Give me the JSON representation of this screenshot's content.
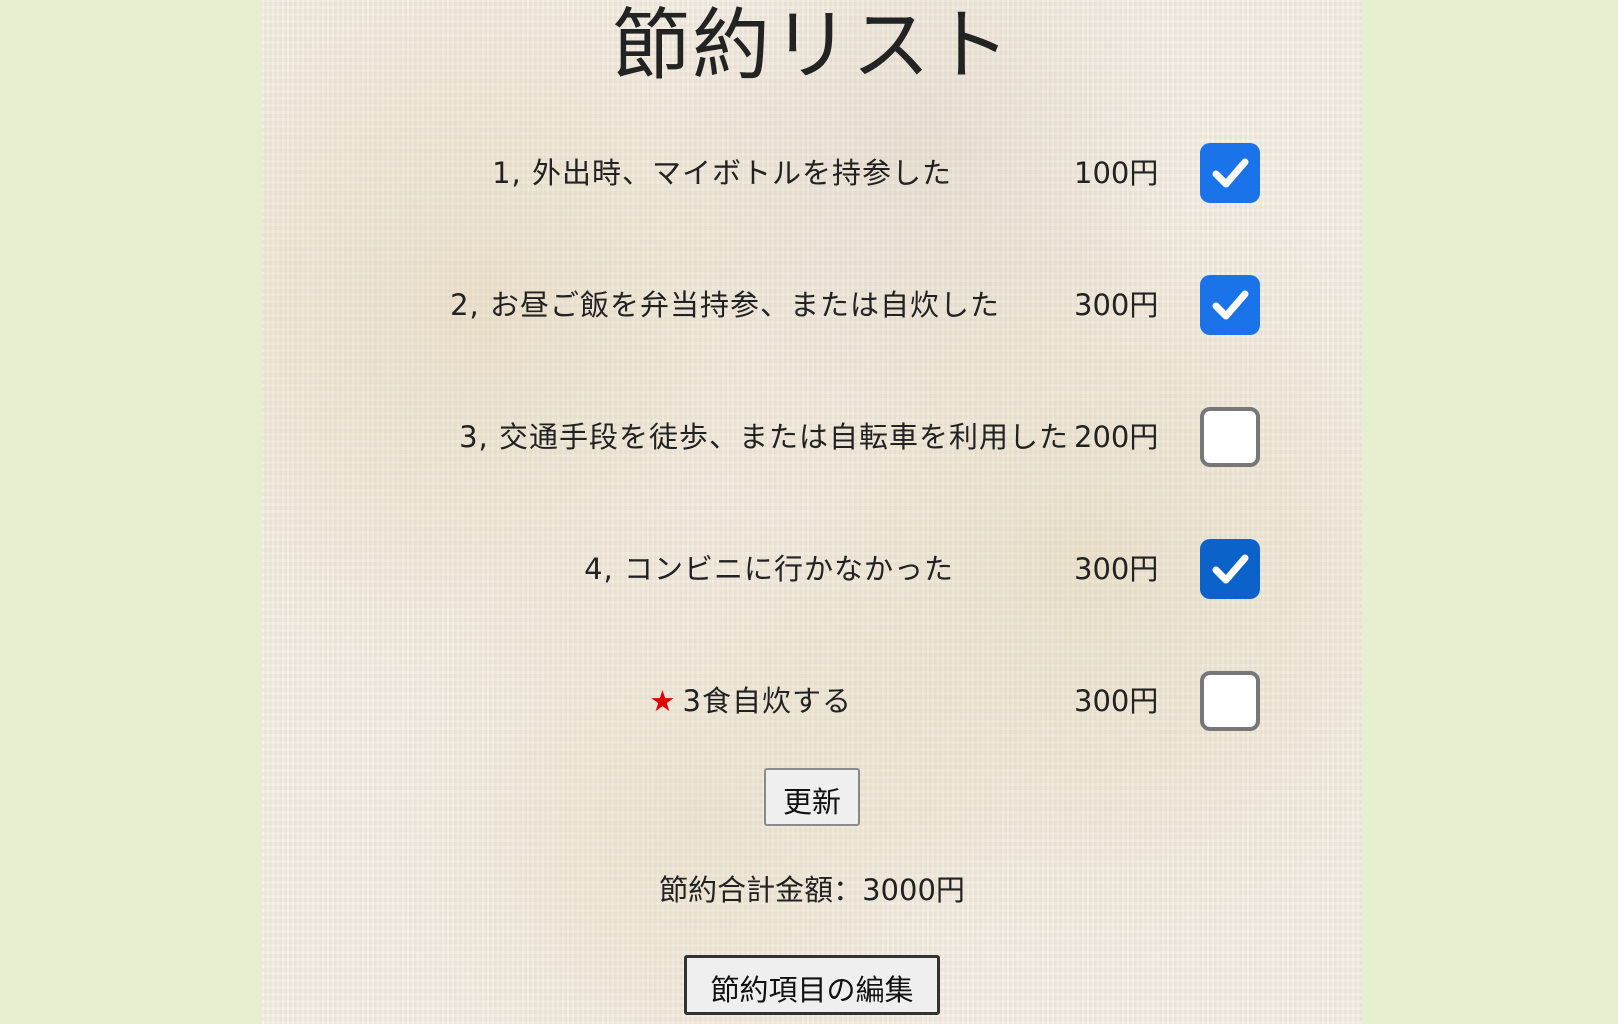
{
  "title": "節約リスト",
  "items": [
    {
      "label": "1, 外出時、マイボトルを持参した",
      "amount": "100円",
      "checked": true
    },
    {
      "label": "2, お昼ご飯を弁当持参、または自炊した",
      "amount": "300円",
      "checked": true
    },
    {
      "label": "3, 交通手段を徒歩、または自転車を利用した",
      "amount": "200円",
      "checked": false
    },
    {
      "label": "4, コンビニに行かなかった",
      "amount": "300円",
      "checked": true
    },
    {
      "star": "★",
      "label": "3食自炊する",
      "amount": "300円",
      "checked": false
    }
  ],
  "update_button": "更新",
  "total": "節約合計金額：3000円",
  "edit_button": "節約項目の編集",
  "colors": {
    "page_background": "#e6efcf",
    "checkbox_checked": "#1a73e8",
    "star": "#e00000"
  },
  "icons": {
    "checkmark": "check-icon"
  }
}
